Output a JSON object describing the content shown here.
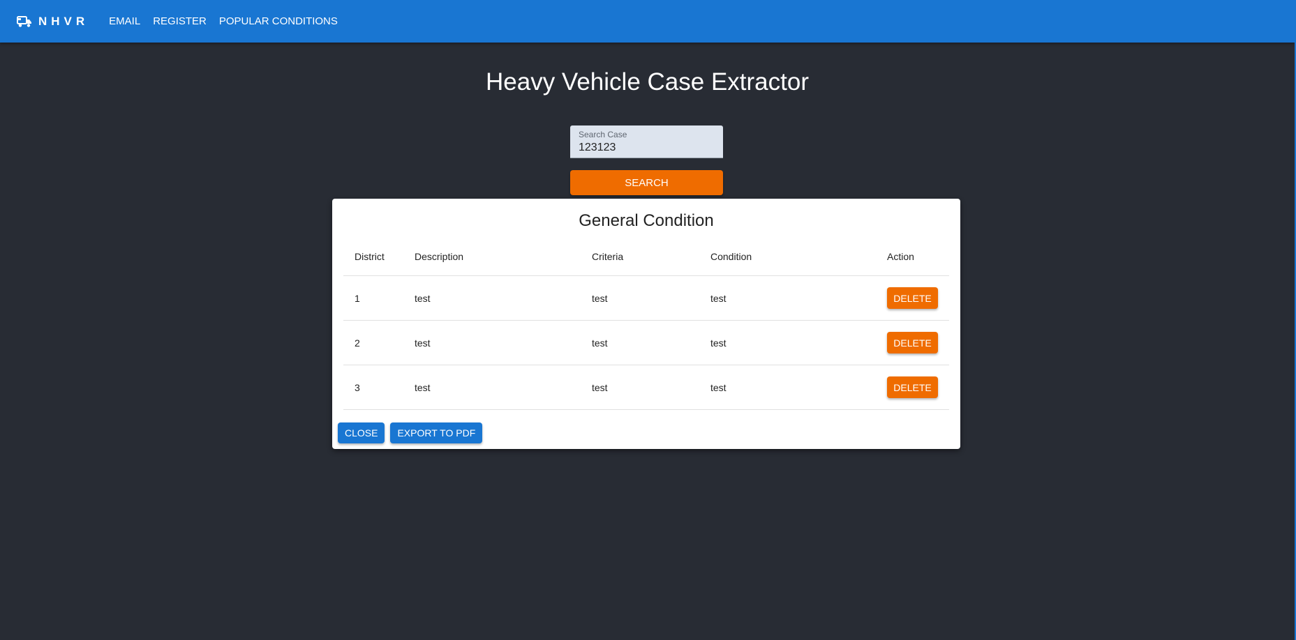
{
  "appbar": {
    "brand_icon": "truck-icon",
    "brand": "NHVR",
    "nav": [
      "EMAIL",
      "REGISTER",
      "POPULAR CONDITIONS"
    ]
  },
  "page": {
    "title": "Heavy Vehicle Case Extractor"
  },
  "search": {
    "label": "Search Case",
    "value": "123123",
    "button": "SEARCH"
  },
  "card": {
    "title": "General Condition",
    "columns": [
      "District",
      "Description",
      "Criteria",
      "Condition",
      "Action"
    ],
    "rows": [
      {
        "district": "1",
        "description": "test",
        "criteria": "test",
        "condition": "test",
        "action": "DELETE"
      },
      {
        "district": "2",
        "description": "test",
        "criteria": "test",
        "condition": "test",
        "action": "DELETE"
      },
      {
        "district": "3",
        "description": "test",
        "criteria": "test",
        "condition": "test",
        "action": "DELETE"
      }
    ],
    "close": "CLOSE",
    "export": "EXPORT TO PDF"
  },
  "colors": {
    "appbar": "#1976d2",
    "background": "#282c34",
    "accent": "#ef6c00"
  }
}
